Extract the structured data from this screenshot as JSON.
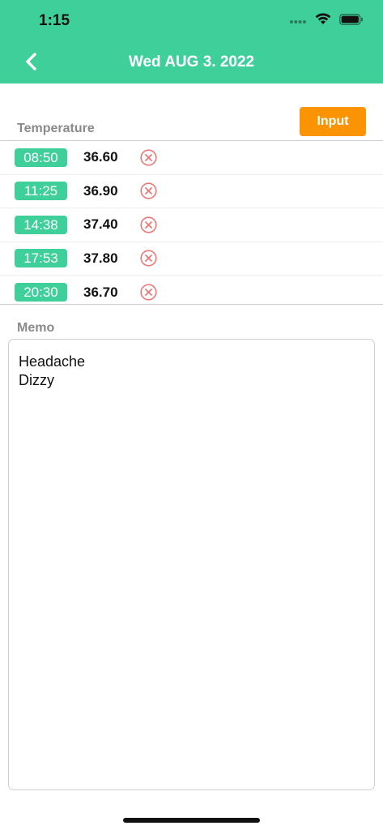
{
  "theme": {
    "accent": "#3ecf9a",
    "orange": "#fb9405",
    "delete_red": "#ea7a7a"
  },
  "status_bar": {
    "time": "1:15",
    "icons": [
      "signal-dots-icon",
      "wifi-icon",
      "battery-icon"
    ]
  },
  "nav": {
    "back_icon": "chevron-left-icon",
    "title": "Wed AUG 3. 2022"
  },
  "temperature": {
    "label": "Temperature",
    "input_button": "Input",
    "rows": [
      {
        "time": "08:50",
        "value": "36.60"
      },
      {
        "time": "11:25",
        "value": "36.90"
      },
      {
        "time": "14:38",
        "value": "37.40"
      },
      {
        "time": "17:53",
        "value": "37.80"
      },
      {
        "time": "20:30",
        "value": "36.70"
      }
    ]
  },
  "memo": {
    "label": "Memo",
    "text": "Headache\nDizzy"
  }
}
